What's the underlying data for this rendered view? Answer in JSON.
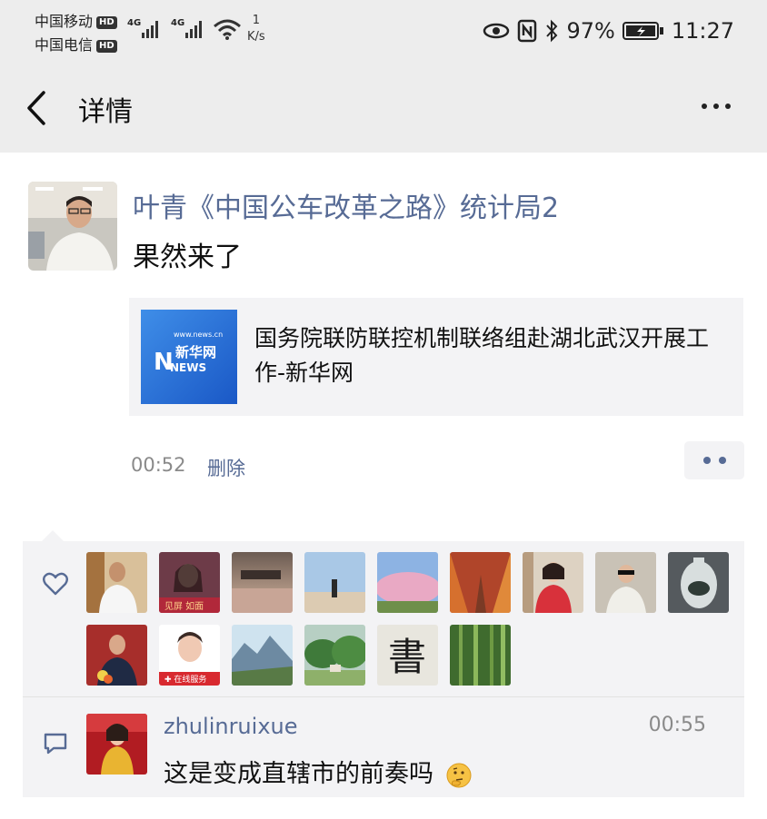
{
  "status_bar": {
    "carrier1": "中国移动",
    "carrier2": "中国电信",
    "hd": "HD",
    "net1": "4G",
    "net2": "4G",
    "speed_value": "1",
    "speed_unit": "K/s",
    "battery": "97%",
    "time": "11:27"
  },
  "nav": {
    "title": "详情"
  },
  "post": {
    "author": "叶青《中国公车改革之路》统计局2",
    "text": "果然来了",
    "link": {
      "title": "国务院联防联控机制联络组赴湖北武汉开展工作-新华网",
      "thumb_site": "www.news.cn",
      "thumb_brand": "新华网",
      "thumb_sub": "NEWS"
    },
    "time": "00:52",
    "delete_label": "删除"
  },
  "likes": {
    "count_avatars": 15,
    "calligraphy_char": "書"
  },
  "comments": [
    {
      "name": "zhulinruixue",
      "time": "00:55",
      "text": "这是变成直辖市的前奏吗"
    }
  ]
}
